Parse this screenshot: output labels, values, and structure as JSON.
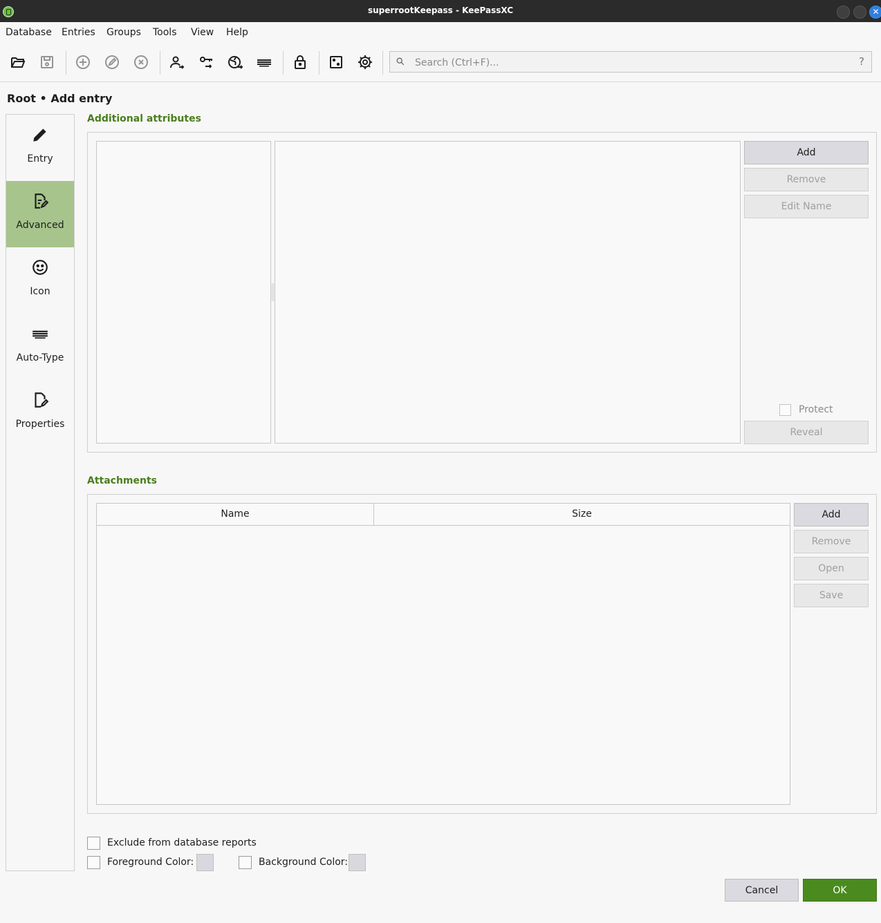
{
  "window": {
    "title": "superrootKeepass - KeePassXC"
  },
  "menubar": {
    "items": [
      "Database",
      "Entries",
      "Groups",
      "Tools",
      "View",
      "Help"
    ]
  },
  "search": {
    "placeholder": "Search (Ctrl+F)...",
    "help": "?"
  },
  "breadcrumb": "Root • Add entry",
  "sidebar": {
    "items": [
      {
        "label": "Entry",
        "icon": "pencil-icon",
        "active": false
      },
      {
        "label": "Advanced",
        "icon": "document-edit-icon",
        "active": true
      },
      {
        "label": "Icon",
        "icon": "smiley-icon",
        "active": false
      },
      {
        "label": "Auto-Type",
        "icon": "keyboard-icon",
        "active": false
      },
      {
        "label": "Properties",
        "icon": "file-properties-icon",
        "active": false
      }
    ]
  },
  "attributes": {
    "title": "Additional attributes",
    "add": "Add",
    "remove": "Remove",
    "edit_name": "Edit Name",
    "protect": "Protect",
    "reveal": "Reveal"
  },
  "attachments": {
    "title": "Attachments",
    "columns": [
      "Name",
      "Size"
    ],
    "add": "Add",
    "remove": "Remove",
    "open": "Open",
    "save": "Save"
  },
  "options": {
    "exclude_reports": "Exclude from database reports",
    "foreground_color": "Foreground Color:",
    "background_color": "Background Color:"
  },
  "dialog": {
    "cancel": "Cancel",
    "ok": "OK"
  },
  "colors": {
    "accent_green": "#4b8a1f",
    "sidebar_active": "#a6c48b",
    "section_title": "#4b7d1e"
  }
}
